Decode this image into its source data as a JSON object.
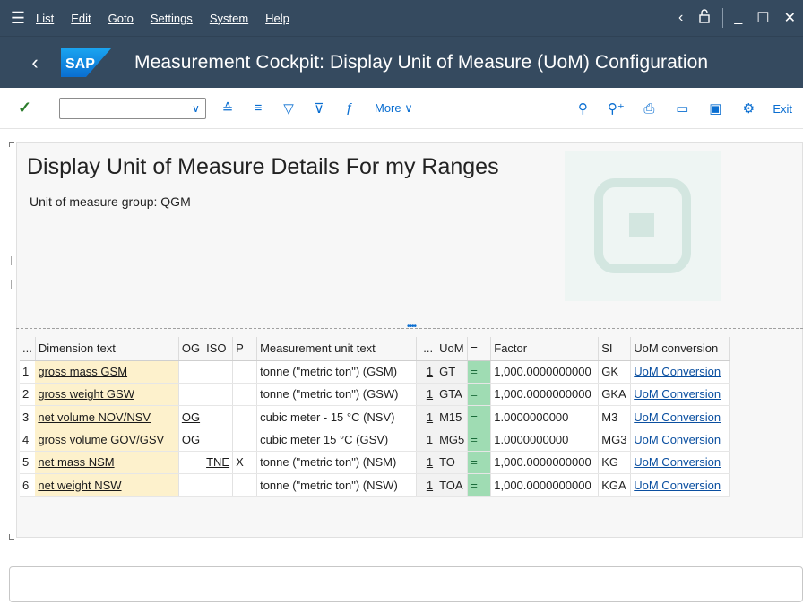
{
  "menubar": {
    "items": [
      {
        "label": "List"
      },
      {
        "label": "Edit"
      },
      {
        "label": "Goto"
      },
      {
        "label": "Settings"
      },
      {
        "label": "System"
      },
      {
        "label": "Help"
      }
    ]
  },
  "titlebar": {
    "logo": "SAP",
    "title": "Measurement Cockpit: Display Unit of Measure (UoM) Configuration"
  },
  "toolbar": {
    "command_value": "",
    "more_label": "More",
    "exit_label": "Exit"
  },
  "page": {
    "title": "Display Unit of Measure Details For my Ranges",
    "subtitle": "Unit of measure group: QGM"
  },
  "table": {
    "headers": {
      "rownum": "...",
      "dimension": "Dimension text",
      "og": "OG",
      "iso": "ISO",
      "p": "P",
      "unit_text": "Measurement unit text",
      "uom_num": "...",
      "uom": "UoM",
      "eq": "=",
      "factor": "Factor",
      "si": "SI",
      "conversion": "UoM conversion"
    },
    "rows": [
      {
        "n": "1",
        "dimension": "gross mass GSM",
        "og": "",
        "iso": "",
        "p": "",
        "unit_text": "tonne (\"metric ton\") (GSM)",
        "num": "1",
        "uom": "GT",
        "eq": "=",
        "factor": "1,000.0000000000",
        "si": "GK",
        "conversion": "UoM Conversion"
      },
      {
        "n": "2",
        "dimension": "gross weight GSW",
        "og": "",
        "iso": "",
        "p": "",
        "unit_text": "tonne (\"metric ton\") (GSW)",
        "num": "1",
        "uom": "GTA",
        "eq": "=",
        "factor": "1,000.0000000000",
        "si": "GKA",
        "conversion": "UoM Conversion"
      },
      {
        "n": "3",
        "dimension": "net volume NOV/NSV",
        "og": "OG",
        "iso": "",
        "p": "",
        "unit_text": "cubic meter - 15 °C (NSV)",
        "num": "1",
        "uom": "M15",
        "eq": "=",
        "factor": "1.0000000000",
        "si": "M3",
        "conversion": "UoM Conversion"
      },
      {
        "n": "4",
        "dimension": "gross volume GOV/GSV",
        "og": "OG",
        "iso": "",
        "p": "",
        "unit_text": "cubic meter 15 °C (GSV)",
        "num": "1",
        "uom": "MG5",
        "eq": "=",
        "factor": "1.0000000000",
        "si": "MG3",
        "conversion": "UoM Conversion"
      },
      {
        "n": "5",
        "dimension": "net mass NSM",
        "og": "",
        "iso": "TNE",
        "p": "X",
        "unit_text": "tonne (\"metric ton\") (NSM)",
        "num": "1",
        "uom": "TO",
        "eq": "=",
        "factor": "1,000.0000000000",
        "si": "KG",
        "conversion": "UoM Conversion"
      },
      {
        "n": "6",
        "dimension": "net weight NSW",
        "og": "",
        "iso": "",
        "p": "",
        "unit_text": "tonne (\"metric ton\") (NSW)",
        "num": "1",
        "uom": "TOA",
        "eq": "=",
        "factor": "1,000.0000000000",
        "si": "KGA",
        "conversion": "UoM Conversion"
      }
    ]
  },
  "colors": {
    "shell": "#354a5f",
    "accent": "#0a6ed1",
    "dimension_bg": "#fdf1cc",
    "equals_bg": "#9fdcb3"
  }
}
